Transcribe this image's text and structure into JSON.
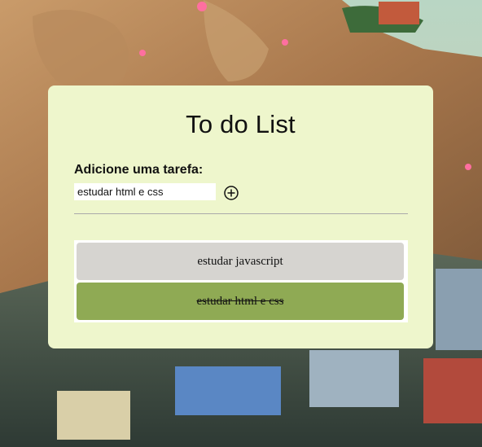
{
  "app": {
    "title": "To do List",
    "add_label": "Adicione uma tarefa:",
    "input": {
      "value": "estudar html e css",
      "placeholder": ""
    },
    "add_button_icon": "plus-circle-icon"
  },
  "tasks": [
    {
      "text": "estudar javascript",
      "done": false
    },
    {
      "text": "estudar html e css",
      "done": true
    }
  ],
  "colors": {
    "card": "#eef6cc",
    "pending_task": "#d6d4d0",
    "done_task": "#8faa54"
  }
}
